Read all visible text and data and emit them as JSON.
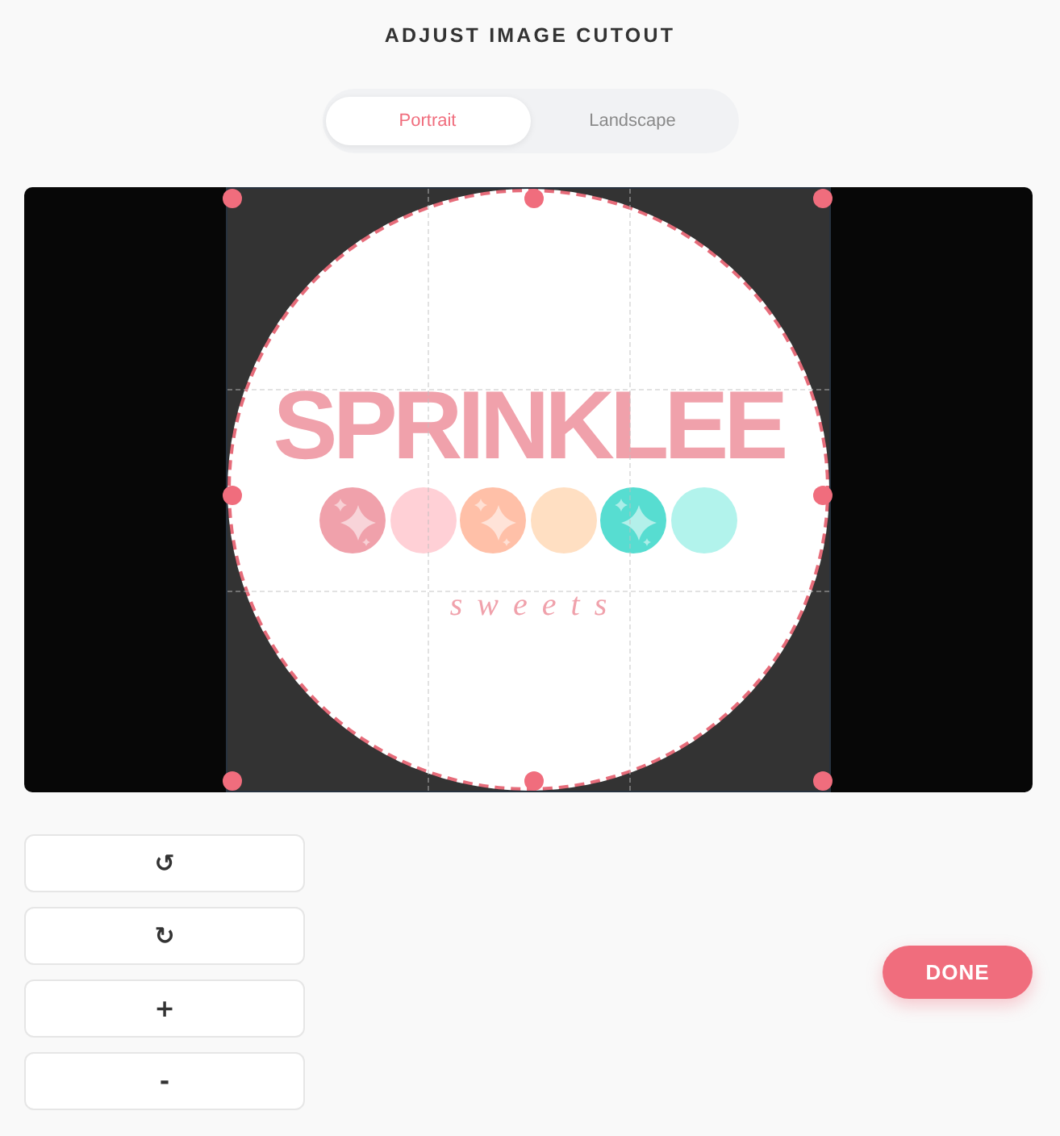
{
  "title": "ADJUST IMAGE CUTOUT",
  "tabs": [
    {
      "label": "Portrait",
      "selected": true
    },
    {
      "label": "Landscape",
      "selected": false
    }
  ],
  "image": {
    "logo_title": "SPRINKLEE",
    "dots": [
      {
        "color": "#f0a1ab",
        "kind": "sparkle"
      },
      {
        "color": "#ffd0d6",
        "kind": "plain"
      },
      {
        "color": "#ffc0a8",
        "kind": "sparkle"
      },
      {
        "color": "#ffdfc2",
        "kind": "plain"
      },
      {
        "color": "#57ddd1",
        "kind": "sparkle"
      },
      {
        "color": "#b2f3ec",
        "kind": "plain"
      }
    ],
    "logo_subtitle": "sweets"
  },
  "controls": [
    {
      "label": "↺"
    },
    {
      "label": "↻"
    },
    {
      "label": "+"
    },
    {
      "label": "-"
    }
  ],
  "done_button": {
    "label": "DONE"
  }
}
